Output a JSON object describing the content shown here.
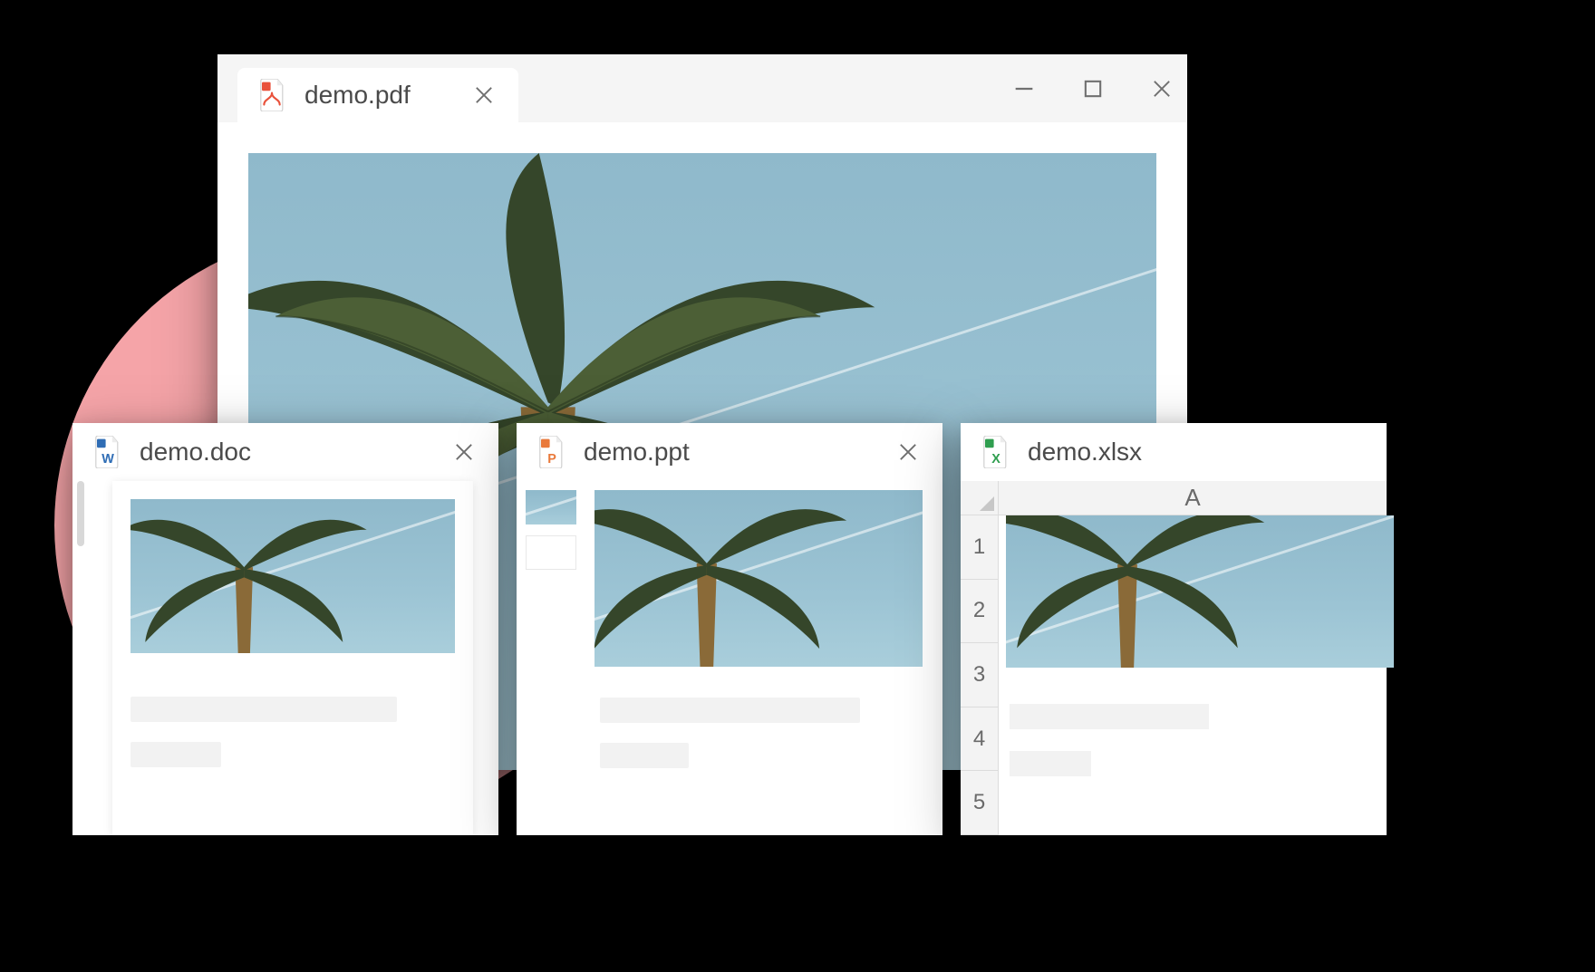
{
  "pdf": {
    "tab_label": "demo.pdf"
  },
  "doc": {
    "tab_label": "demo.doc"
  },
  "ppt": {
    "tab_label": "demo.ppt"
  },
  "xlsx": {
    "tab_label": "demo.xlsx",
    "col_header": "A",
    "rows": [
      "1",
      "2",
      "3",
      "4",
      "5"
    ]
  },
  "icon_colors": {
    "pdf": "#e9513b",
    "doc": "#2f6db5",
    "ppt": "#e9793b",
    "xlsx": "#2f9e4f"
  }
}
